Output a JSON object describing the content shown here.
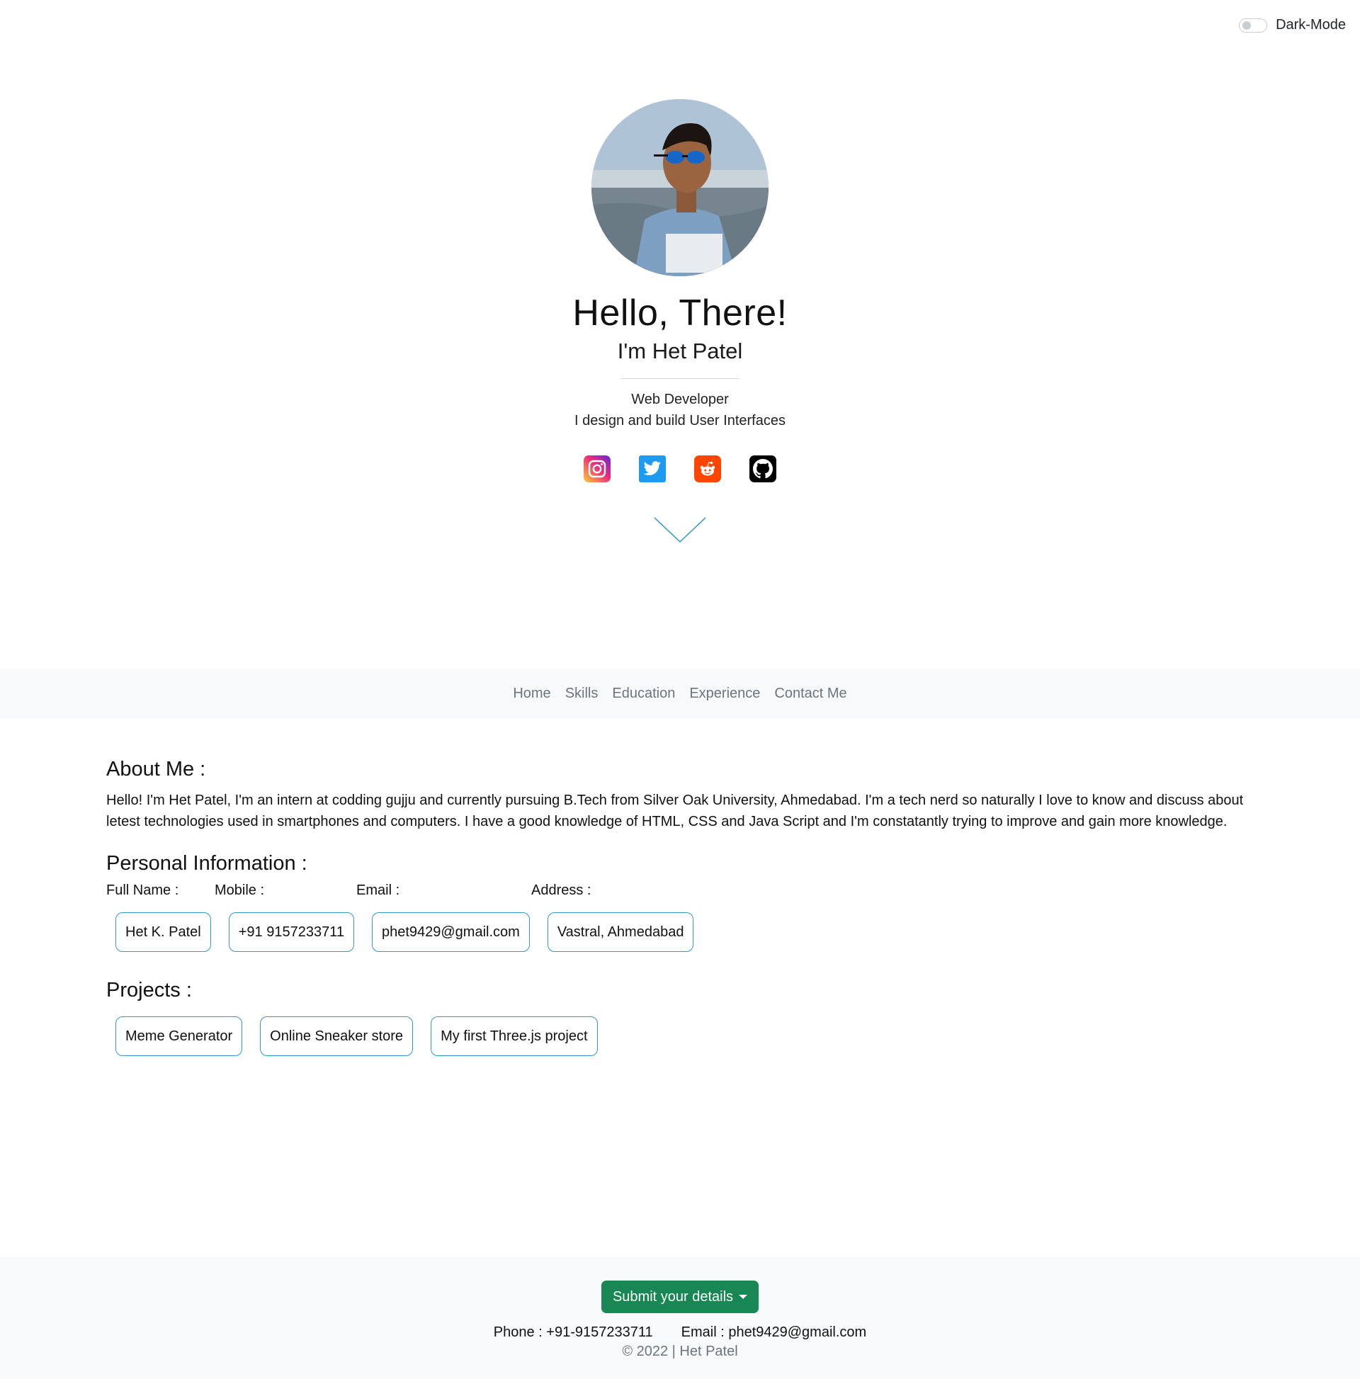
{
  "dark_mode": {
    "label": "Dark-Mode",
    "enabled": false
  },
  "hero": {
    "greeting": "Hello, There!",
    "name_line": "I'm Het Patel",
    "role": "Web Developer",
    "tagline": "I design and build User Interfaces",
    "socials": [
      {
        "name": "instagram",
        "icon": "instagram-icon"
      },
      {
        "name": "twitter",
        "icon": "twitter-icon"
      },
      {
        "name": "reddit",
        "icon": "reddit-icon"
      },
      {
        "name": "github",
        "icon": "github-icon"
      }
    ],
    "scroll_icon": "chevron-down-icon"
  },
  "nav": {
    "items": [
      "Home",
      "Skills",
      "Education",
      "Experience",
      "Contact Me"
    ]
  },
  "about": {
    "title": "About Me :",
    "text": "Hello! I'm Het Patel, I'm an intern at codding gujju and currently pursuing B.Tech from Silver Oak University, Ahmedabad. I'm a tech nerd so naturally I love to know and discuss about letest technologies used in smartphones and computers. I have a good knowledge of HTML, CSS and Java Script and I'm constatantly trying to improve and gain more knowledge."
  },
  "personal": {
    "title": "Personal Information :",
    "labels": {
      "full_name": "Full Name :",
      "mobile": "Mobile :",
      "email": "Email :",
      "address": "Address :"
    },
    "values": {
      "full_name": "Het K. Patel",
      "mobile": "+91 9157233711",
      "email": "phet9429@gmail.com",
      "address": "Vastral, Ahmedabad"
    }
  },
  "projects": {
    "title": "Projects :",
    "items": [
      "Meme Generator",
      "Online Sneaker store",
      "My first Three.js project"
    ]
  },
  "footer": {
    "submit_label": "Submit your details",
    "phone": "Phone : +91-9157233711",
    "email": "Email : phet9429@gmail.com",
    "copyright": "© 2022 | Het Patel"
  },
  "colors": {
    "accent_border": "#2f9ac4",
    "submit_green": "#198754",
    "nav_bg": "#f8f9fa",
    "nav_text": "#6c757d"
  }
}
